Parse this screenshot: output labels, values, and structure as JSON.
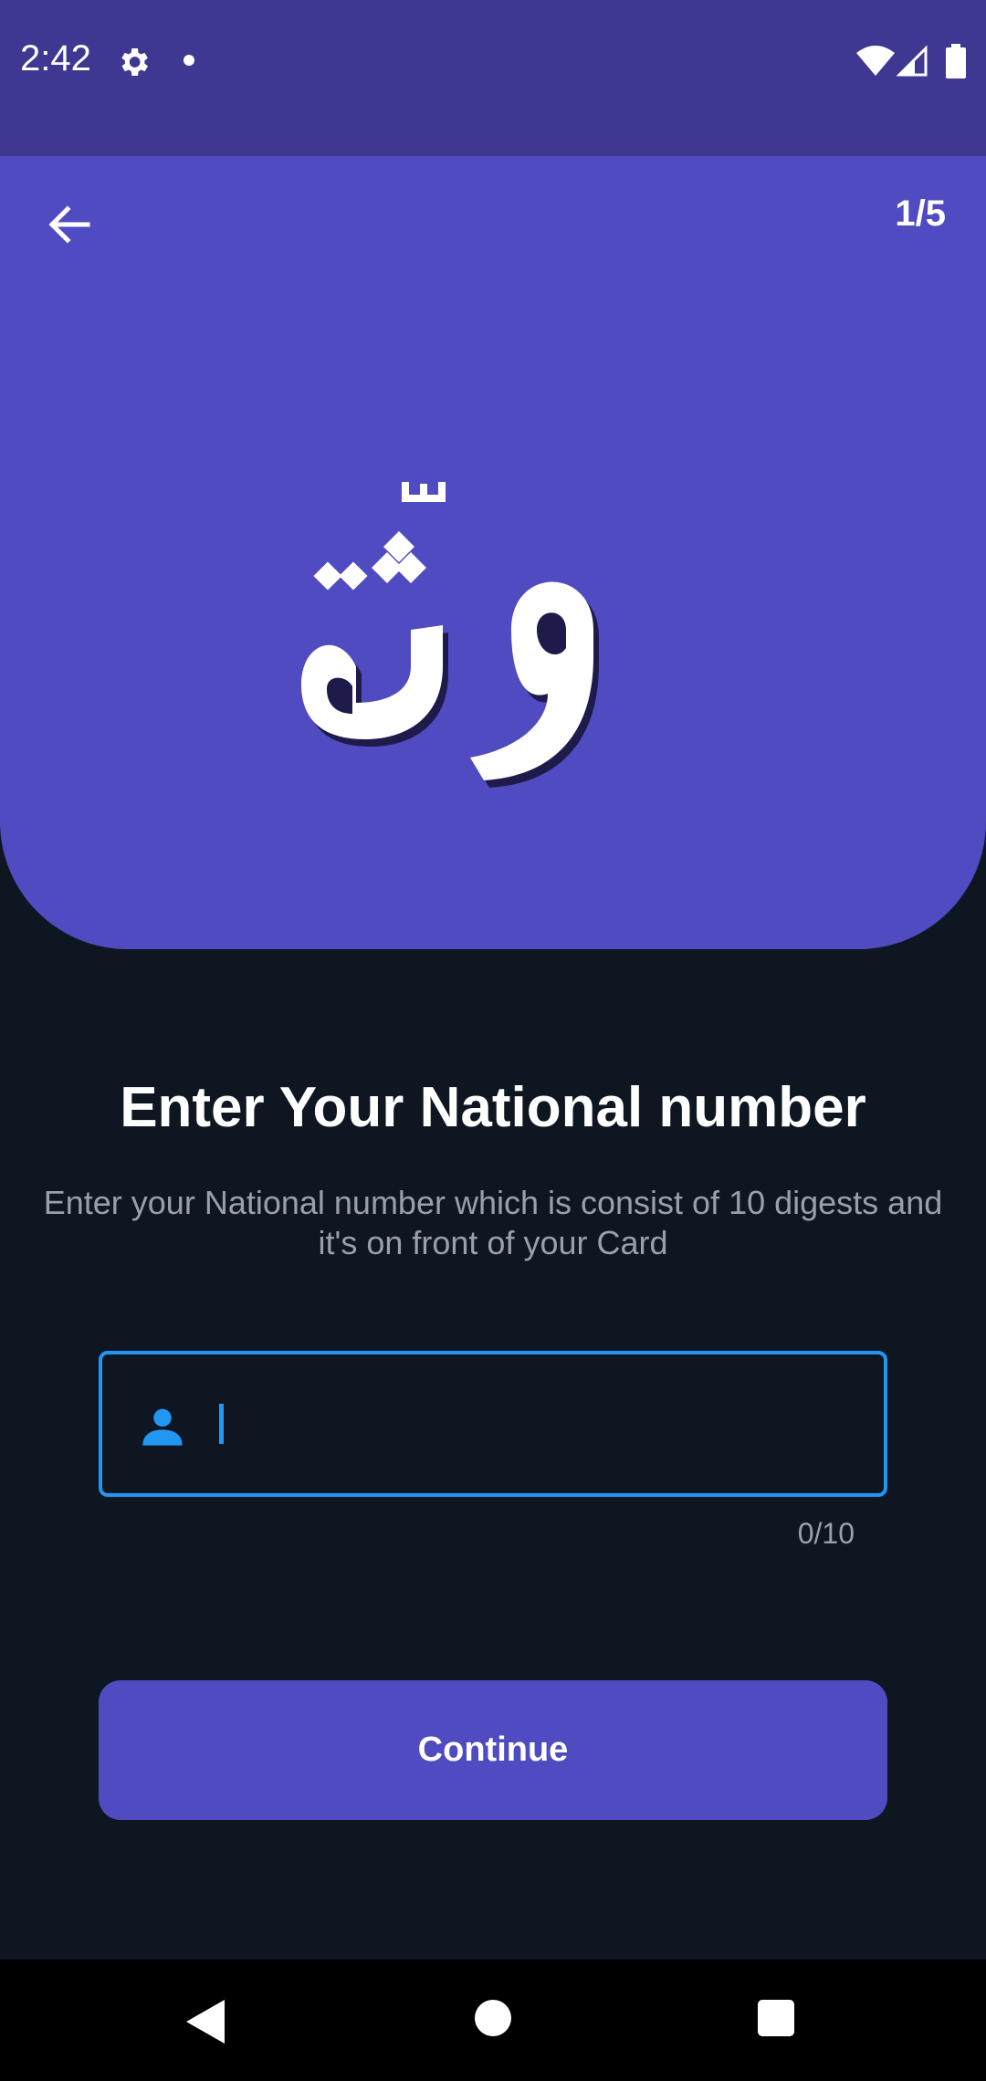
{
  "status_bar": {
    "time": "2:42",
    "icons": [
      "gear-icon",
      "notification-dot-icon",
      "wifi-icon",
      "signal-icon",
      "battery-icon"
    ]
  },
  "header": {
    "step": "1/5",
    "back_icon": "arrow-left-icon",
    "logo_text": "وثّق",
    "background_color": "#514bc2"
  },
  "form": {
    "title": "Enter Your National number",
    "subtitle_line1": "Enter your National number which is consist of 10 digests and",
    "subtitle_line2": "it's on front of your Card",
    "input": {
      "value": "",
      "placeholder": "",
      "icon": "person-icon",
      "focus_color": "#2196f3"
    },
    "counter": "0/10",
    "continue_label": "Continue"
  },
  "nav_bar": {
    "icons": [
      "back-triangle-icon",
      "home-circle-icon",
      "recents-square-icon"
    ]
  },
  "colors": {
    "background": "#0e1622",
    "status_bar": "#3e3892",
    "accent": "#514bc2",
    "input_border": "#2196f3"
  }
}
